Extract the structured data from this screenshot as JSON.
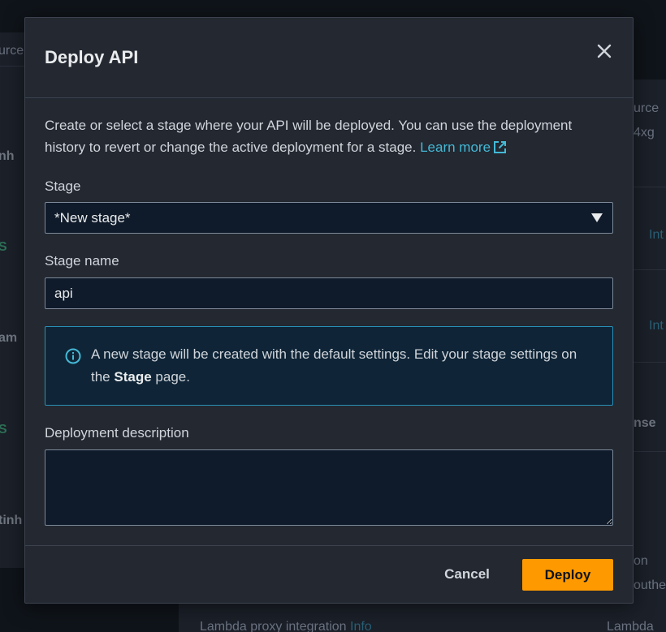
{
  "background": {
    "left_texts": [
      "urce",
      "nh",
      "S",
      "am",
      "S",
      "tinh"
    ],
    "right_texts": [
      "urce",
      "4xg",
      "Int",
      "Int",
      "nse",
      "on",
      "outhe"
    ],
    "bottom_left_text": "Lambda proxy integration",
    "bottom_left_link": "Info",
    "bottom_right_text": "Lambda"
  },
  "modal": {
    "title": "Deploy API",
    "intro_text": "Create or select a stage where your API will be deployed. You can use the deployment history to revert or change the active deployment for a stage.",
    "learn_more": "Learn more",
    "stage_label": "Stage",
    "stage_value": "*New stage*",
    "stage_name_label": "Stage name",
    "stage_name_value": "api",
    "info_text_before": "A new stage will be created with the default settings. Edit your stage settings on the",
    "info_text_bold": "Stage",
    "info_text_after": "page.",
    "description_label": "Deployment description",
    "description_value": "",
    "cancel_label": "Cancel",
    "deploy_label": "Deploy"
  },
  "colors": {
    "accent": "#ff9900",
    "link": "#44b9d6",
    "info_border": "#2a8fb5",
    "info_background": "#0f2537"
  },
  "icons": {
    "close": "close-icon",
    "external_link": "external-link-icon",
    "caret": "caret-down-icon",
    "info": "info-icon"
  }
}
